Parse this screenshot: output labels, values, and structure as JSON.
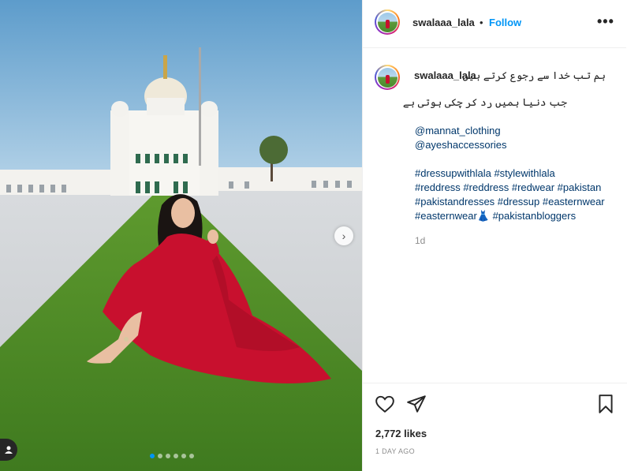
{
  "post": {
    "username": "swalaaa_lala",
    "follow_label": "Follow",
    "separator": "•",
    "more_label": "•••"
  },
  "caption": {
    "username": "swalaaa_lala",
    "urdu_line1": "ہم تب خدا سے رجوع کرتے ہیں",
    "urdu_line2": "جب دنیا ہمیں رد کر چکی ہوتی ہے",
    "mention1": "@mannat_clothing",
    "mention2": "@ayeshaccessories",
    "tag_line1": "#dressupwithlala #stylewithlala",
    "tag_line2": "#reddress #reddress #redwear #pakistan",
    "tag_line3": "#pakistandresses #dressup #easternwear",
    "tag_line4a": "#easternwear",
    "dress_emoji": "👗",
    "tag_line4b": " #pakistanbloggers",
    "age": "1d"
  },
  "carousel": {
    "next_label": "›",
    "dots": 6,
    "active_dot": 0
  },
  "engagement": {
    "likes": "2,772 likes",
    "time_ago": "1 DAY AGO"
  },
  "icons": [
    "heart-icon",
    "share-icon",
    "bookmark-icon",
    "user-tag-icon",
    "chevron-right-icon"
  ],
  "colors": {
    "accent": "#0095f6",
    "text": "#262626",
    "muted": "#8e8e8e",
    "link": "#00376b"
  }
}
